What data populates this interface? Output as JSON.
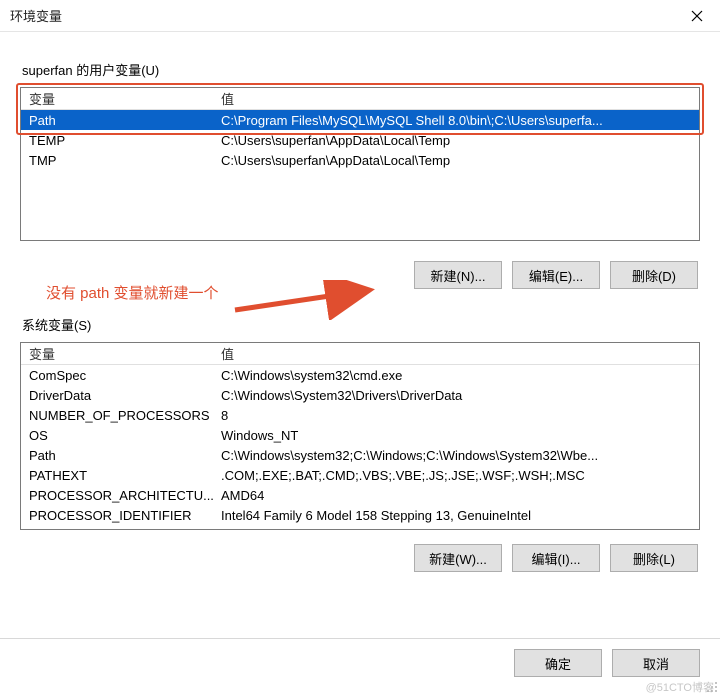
{
  "window": {
    "title": "环境变量"
  },
  "user_section": {
    "label": "superfan 的用户变量(U)",
    "headers": {
      "variable": "变量",
      "value": "值"
    },
    "rows": [
      {
        "variable": "Path",
        "value": "C:\\Program Files\\MySQL\\MySQL Shell 8.0\\bin\\;C:\\Users\\superfa..."
      },
      {
        "variable": "TEMP",
        "value": "C:\\Users\\superfan\\AppData\\Local\\Temp"
      },
      {
        "variable": "TMP",
        "value": "C:\\Users\\superfan\\AppData\\Local\\Temp"
      }
    ],
    "buttons": {
      "new": "新建(N)...",
      "edit": "编辑(E)...",
      "delete": "删除(D)"
    }
  },
  "annotation": {
    "note": "没有 path 变量就新建一个"
  },
  "sys_section": {
    "label": "系统变量(S)",
    "headers": {
      "variable": "变量",
      "value": "值"
    },
    "rows": [
      {
        "variable": "ComSpec",
        "value": "C:\\Windows\\system32\\cmd.exe"
      },
      {
        "variable": "DriverData",
        "value": "C:\\Windows\\System32\\Drivers\\DriverData"
      },
      {
        "variable": "NUMBER_OF_PROCESSORS",
        "value": "8"
      },
      {
        "variable": "OS",
        "value": "Windows_NT"
      },
      {
        "variable": "Path",
        "value": "C:\\Windows\\system32;C:\\Windows;C:\\Windows\\System32\\Wbe..."
      },
      {
        "variable": "PATHEXT",
        "value": ".COM;.EXE;.BAT;.CMD;.VBS;.VBE;.JS;.JSE;.WSF;.WSH;.MSC"
      },
      {
        "variable": "PROCESSOR_ARCHITECTU...",
        "value": "AMD64"
      },
      {
        "variable": "PROCESSOR_IDENTIFIER",
        "value": "Intel64 Family 6 Model 158 Stepping 13, GenuineIntel"
      }
    ],
    "buttons": {
      "new": "新建(W)...",
      "edit": "编辑(I)...",
      "delete": "删除(L)"
    }
  },
  "footer": {
    "ok": "确定",
    "cancel": "取消"
  },
  "watermark": "@51CTO博客"
}
